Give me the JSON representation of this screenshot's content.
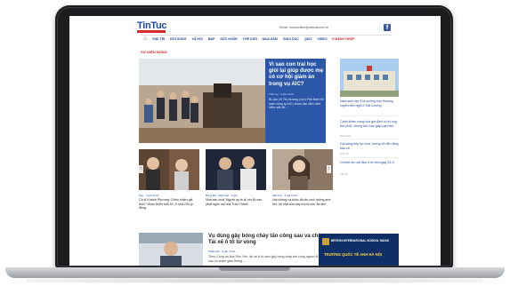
{
  "site": {
    "logo": "TinTuc",
    "email_label": "Email: tintuconline@vietnamnet.vn"
  },
  "nav": {
    "items": [
      "GIẢI TRÍ",
      "ĐỜI SỐNG",
      "XÃ HỘI",
      "BẠP",
      "SỨC KHỎE",
      "THẾ GIỚI",
      "MUA SẮM",
      "GIÁO DỤC",
      "QUIZ",
      "VIDEO"
    ],
    "login": "ĐĂNG NHẬP"
  },
  "section": {
    "title": "SỰ KIỆN NÓNG"
  },
  "hero": {
    "title": "Vì sao con trai học giỏi lại giúp được mẹ có cơ hội giảm án trong vụ AIC?",
    "meta": "Thời sự · 1 giờ trước",
    "summary": "Bị cáo Lê Thị Hương (cựu Phó Ban Kế toán công ty AIC) được đại diện viện kiểm sát đề..."
  },
  "right": {
    "items": [
      {
        "text": "Nam sinh lớp 4 bị cưỡng bức thường xuyên đến nghỉ ở Hải Dương",
        "meta": "Giáo dục"
      },
      {
        "text": "Cảnh khám nóng của giá định có từ ung thư phổi, chồng làm bản giáp hại mẹn",
        "meta": "Sức khỏe"
      },
      {
        "text": "Giá vàng tiếp tục hóa, lượng dữ liệu tăng bảo cõ",
        "meta": "Kinh tế"
      },
      {
        "text": "Chi tiết lớn cải đầu ổ thị hội ngày 24-3",
        "meta": "Xã hội"
      }
    ]
  },
  "cards": [
    {
      "meta": "Sao · 3 giờ trước",
      "text": "Ca sĩ Khánh Phương 'Chiêu khiên giả tinh?' được thiện tuổi 40, ở nhà 200 tỷ đồng"
    },
    {
      "meta": "Bóng Đá · Ngôi sao · 3 giờ",
      "text": "Nhà sản xuất 'Người ấy là ai' xin lỗi sau phát ngôn sai của Trấn Thành"
    },
    {
      "meta": "Văn học · 3 giờ trước",
      "text": "Hai chồng ca khúc đề lên nhớ tưởng anh lớn, lôi nhà của này mà bị cho 'ăn tiền'"
    }
  ],
  "bottom": {
    "title": "Vụ dùng gậy bóng chày tấn công sau va chạm: Tài xế ô tô từ vong",
    "meta": "Pháp luật · 4 giờ trước",
    "summary": "Theo Công an tỉnh Phú Yên, tài xế ô tô cầm gậy bóng chày tấn công người đi xe máy sau va chạm giao thông..."
  },
  "ad": {
    "school": "BRITISH INTERNATIONAL SCHOOL HANOI",
    "headline": "TRƯỜNG QUỐC TẾ ANH HÀ NỘI"
  }
}
